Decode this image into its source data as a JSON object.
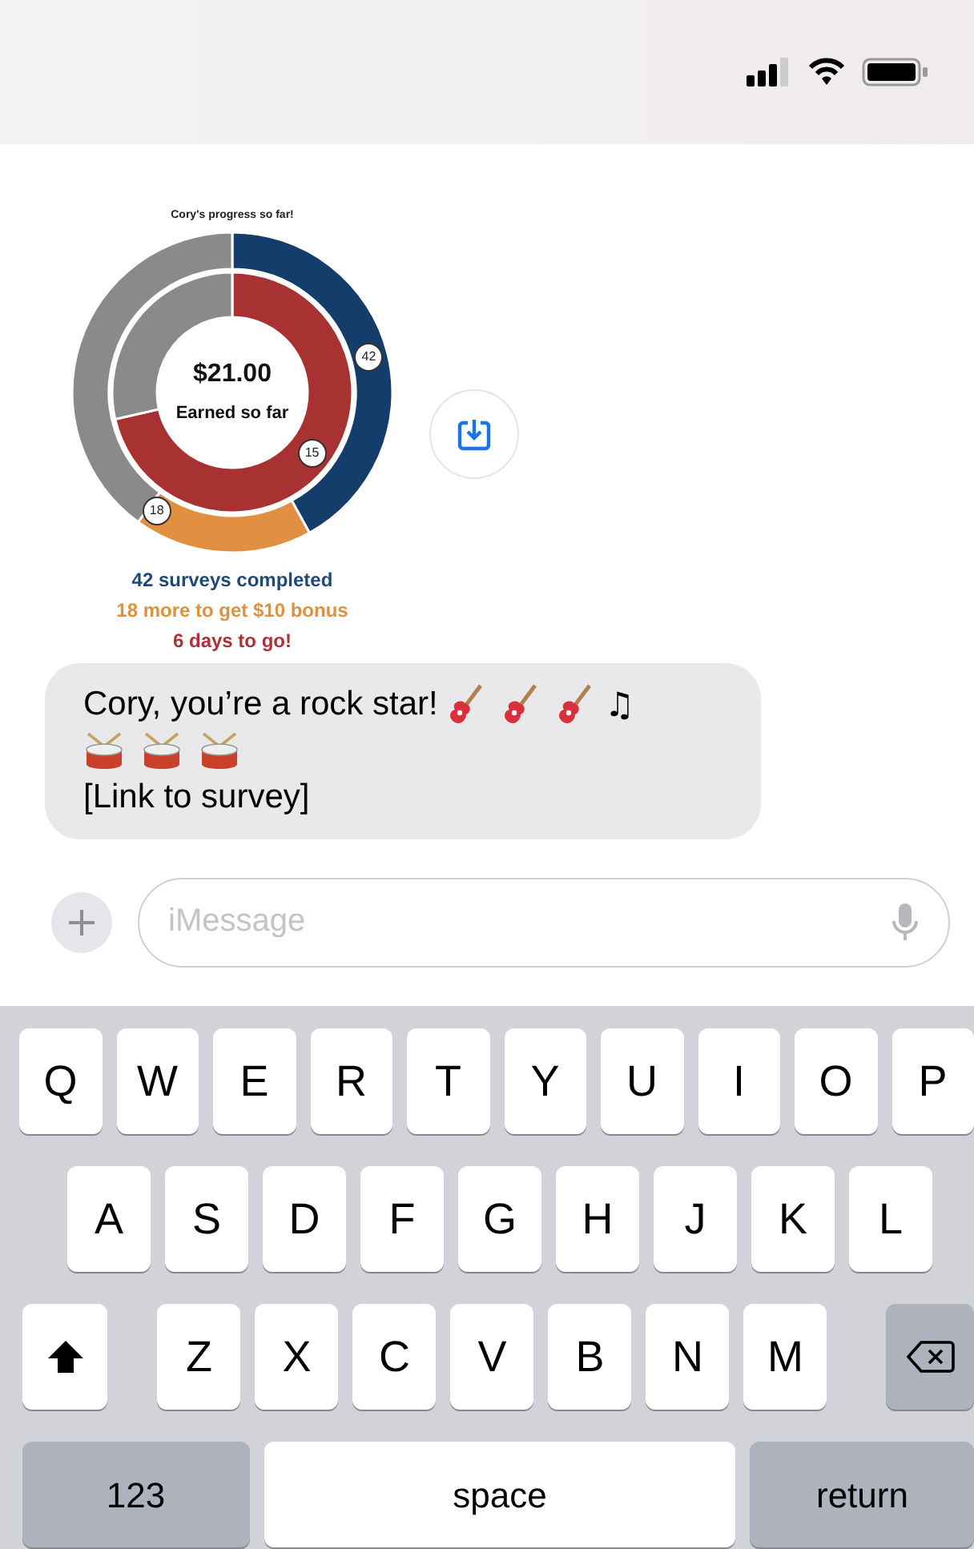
{
  "message_chart": {
    "title": "Cory's progress so far!",
    "slice_labels": [
      {
        "text": "42"
      },
      {
        "text": "15"
      },
      {
        "text": "18"
      }
    ],
    "center_value": "$21.00",
    "center_label": "Earned so far",
    "captions": [
      {
        "text": "42 surveys completed",
        "color": "#1f4a78"
      },
      {
        "text": "18 more to get $10 bonus",
        "color": "#e0913f"
      },
      {
        "text": "6 days to go!",
        "color": "#b0303a"
      }
    ]
  },
  "message": {
    "line1": "Cory, you’re a rock star!",
    "notes": "♫",
    "link": "[Link to survey]"
  },
  "input": {
    "placeholder": "iMessage"
  },
  "keyboard": {
    "rows": [
      [
        "Q",
        "W",
        "E",
        "R",
        "T",
        "Y",
        "U",
        "I",
        "O",
        "P"
      ],
      [
        "A",
        "S",
        "D",
        "F",
        "G",
        "H",
        "J",
        "K",
        "L"
      ],
      [
        "Z",
        "X",
        "C",
        "V",
        "B",
        "N",
        "M"
      ]
    ],
    "numbers_key": "123",
    "space_key": "space",
    "return_key": "return"
  }
}
